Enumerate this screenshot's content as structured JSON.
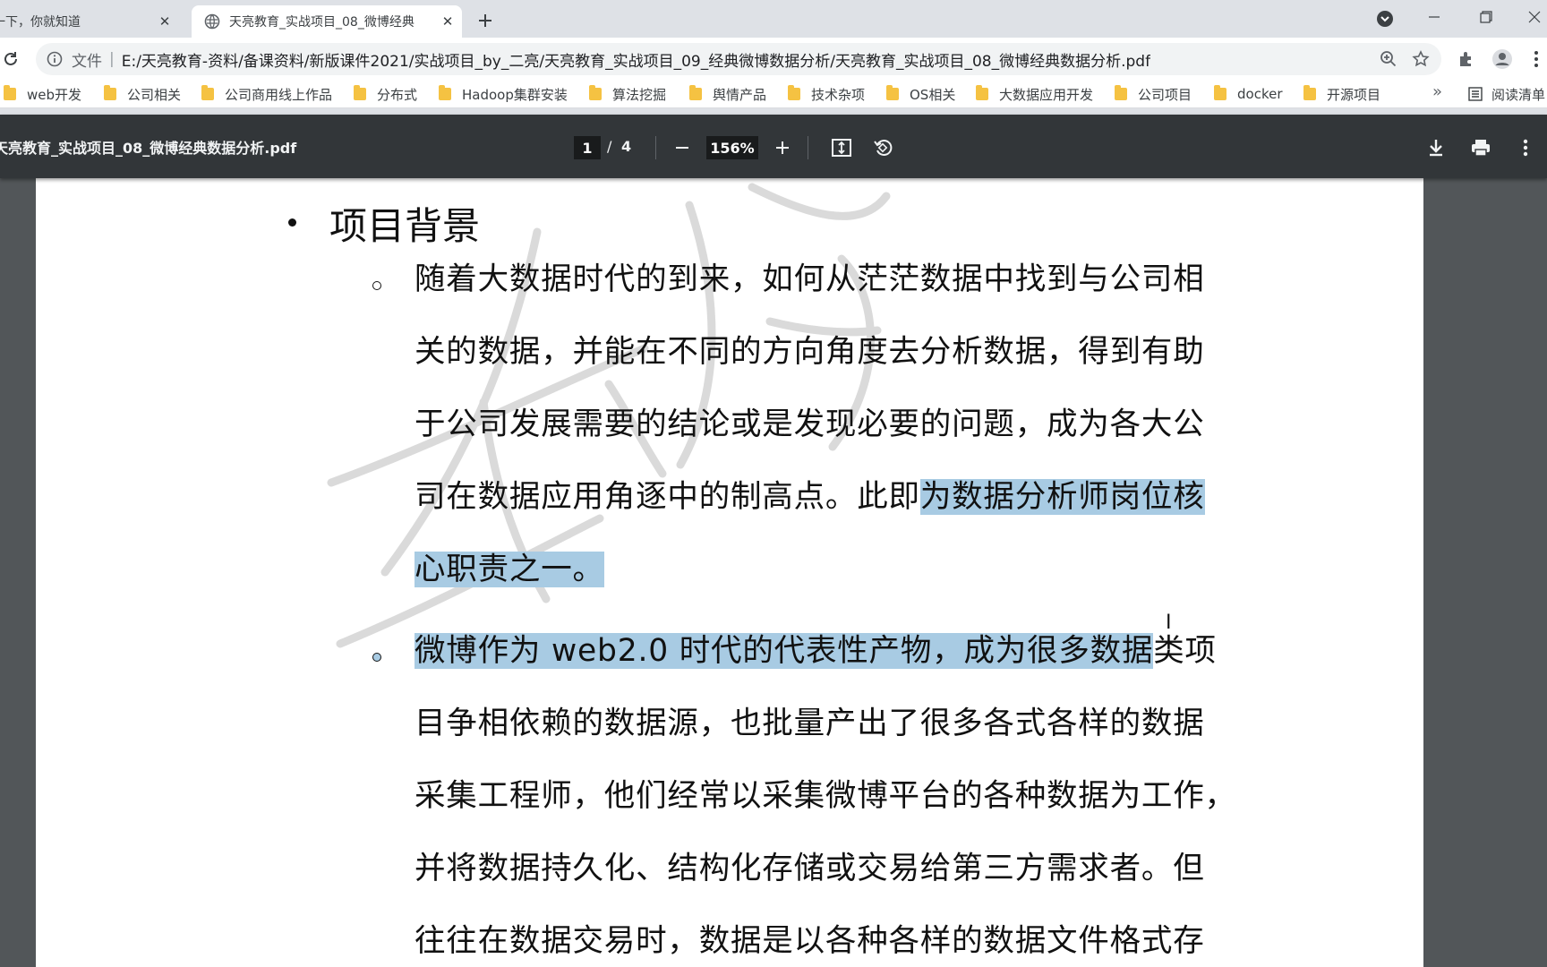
{
  "browser": {
    "tabs": [
      {
        "title": "一下，你就知道",
        "active": false
      },
      {
        "title": "天亮教育_实战项目_08_微博经典",
        "active": true
      }
    ],
    "address": {
      "prefix": "文件",
      "url": "E:/天亮教育-资料/备课资料/新版课件2021/实战项目_by_二亮/天亮教育_实战项目_09_经典微博数据分析/天亮教育_实战项目_08_微博经典数据分析.pdf"
    },
    "bookmarks": [
      "web开发",
      "公司相关",
      "公司商用线上作品",
      "分布式",
      "Hadoop集群安装",
      "算法挖掘",
      "舆情产品",
      "技术杂项",
      "OS相关",
      "大数据应用开发",
      "公司项目",
      "docker",
      "开源项目"
    ],
    "reading_list": "阅读清单",
    "more": "»"
  },
  "pdf": {
    "title": "天亮教育_实战项目_08_微博经典数据分析.pdf",
    "page": "1",
    "page_sep": "/",
    "total_pages": "4",
    "zoom": "156%"
  },
  "document": {
    "heading": "项目背景",
    "para1": {
      "lines": [
        "随着大数据时代的到来，如何从茫茫数据中找到与公司相",
        "关的数据，并能在不同的方向角度去分析数据，得到有助",
        "于公司发展需要的结论或是发现必要的问题，成为各大公"
      ],
      "line4_plain": "司在数据应用角逐中的制高点。此即",
      "line4_hl": "为数据分析师岗位核",
      "line5_hl": "心职责之一。"
    },
    "para2": {
      "line1_hl_a": "微博作为 ",
      "line1_hl_b": "web2.0",
      "line1_hl_c": " 时代的代表性产物，成为很多数据",
      "line1_plain": "类项",
      "lines": [
        "目争相依赖的数据源，也批量产出了很多各式各样的数据",
        "采集工程师，他们经常以采集微博平台的各种数据为工作，",
        "并将数据持久化、结构化存储或交易给第三方需求者。但",
        "往往在数据交易时，数据是以各种各样的数据文件格式存"
      ]
    }
  }
}
